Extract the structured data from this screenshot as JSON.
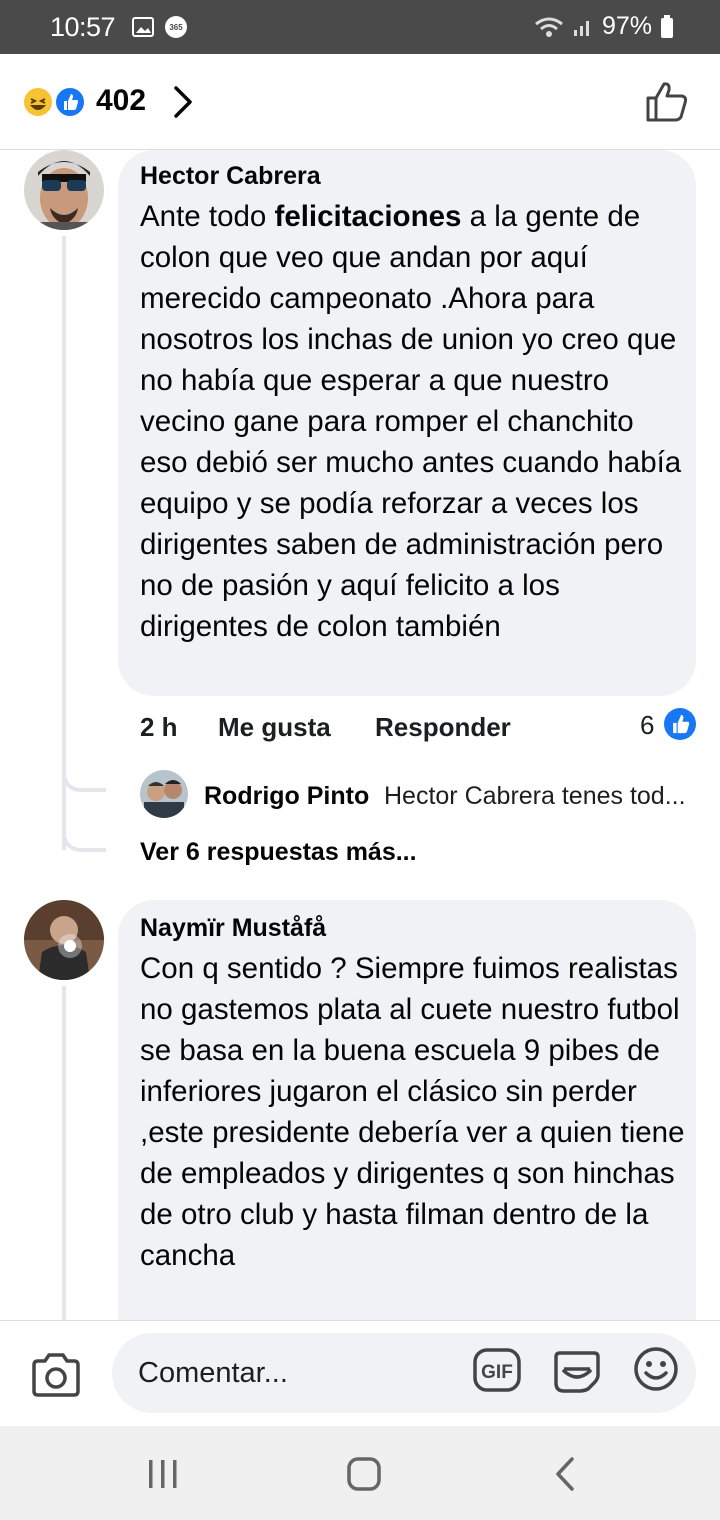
{
  "status_bar": {
    "time": "10:57",
    "battery": "97%"
  },
  "header": {
    "reaction_count": "402"
  },
  "comments": [
    {
      "author": "Hector Cabrera",
      "text_pre": "Ante todo ",
      "text_bold": "felicitaciones",
      "text_post": " a la gente de colon que veo que andan por aquí merecido campeonato .Ahora para nosotros los inchas de union yo creo que no había que esperar a que nuestro vecino gane para romper el chanchito eso debió ser mucho antes cuando había equipo y se podía reforzar a veces los dirigentes saben de administración pero no de pasión y aquí felicito a los dirigentes de colon también",
      "time": "2 h",
      "like_label": "Me gusta",
      "reply_label": "Responder",
      "like_count": "6",
      "reply_preview": {
        "author": "Rodrigo Pinto",
        "text": "Hector Cabrera tenes tod..."
      },
      "more_replies": "Ver 6 respuestas más..."
    },
    {
      "author": "Naymïr Muståfå",
      "text": "Con q sentido ? Siempre fuimos realistas no gastemos plata al cuete nuestro futbol se basa en la buena escuela 9 pibes de inferiores jugaron el clásico sin perder ,este presidente debería ver a quien tiene de empleados y dirigentes q son hinchas de otro club y hasta filman dentro de la cancha"
    }
  ],
  "composer": {
    "placeholder": "Comentar..."
  },
  "colors": {
    "accent": "#1877f2",
    "bubble": "#f0f2f5",
    "status_bar": "#4a4a4a"
  }
}
